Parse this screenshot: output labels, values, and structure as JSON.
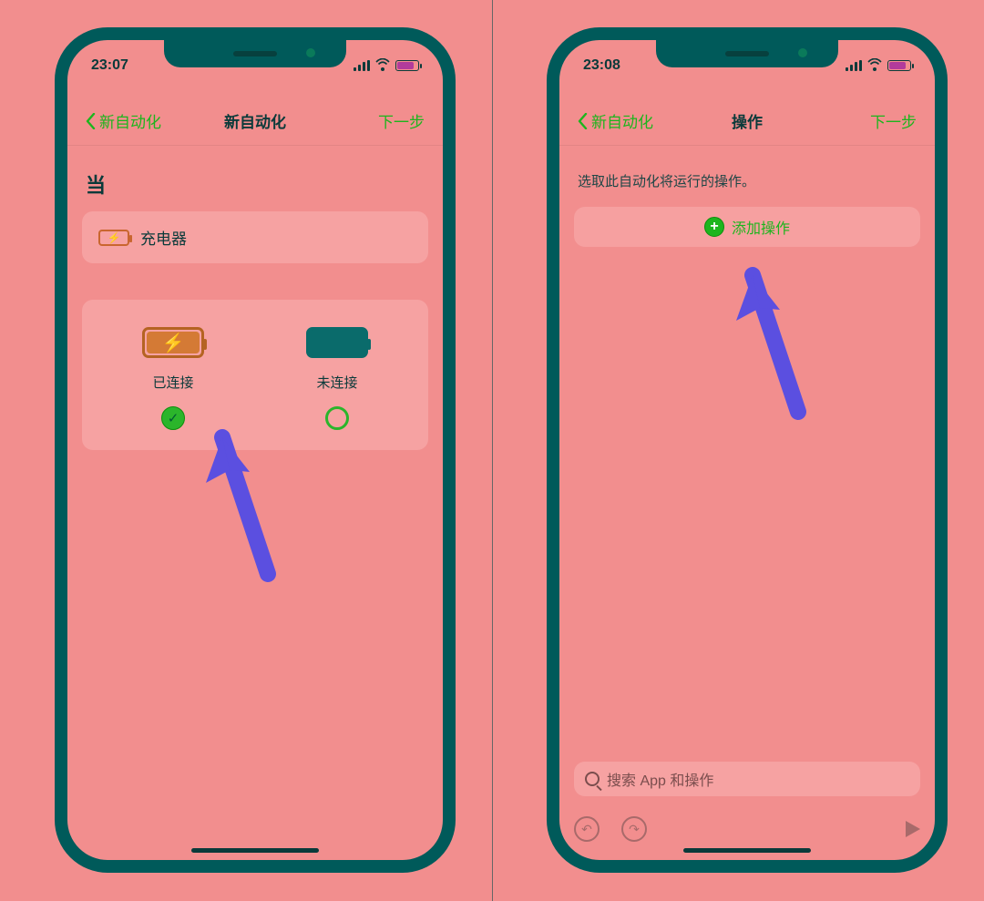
{
  "colors": {
    "accent_green": "#1db51d",
    "phone_frame": "#005a5a",
    "background_tint": "#f28e8e",
    "arrow": "#5b4fe0",
    "battery_status": "#b33b9b"
  },
  "phone_left": {
    "status_time": "23:07",
    "nav": {
      "back": "新自动化",
      "title": "新自动化",
      "next": "下一步"
    },
    "when_label": "当",
    "trigger": {
      "label": "充电器",
      "icon": "charger-icon"
    },
    "options": [
      {
        "id": "connected",
        "label": "已连接",
        "icon": "battery-charging-icon",
        "selected": true
      },
      {
        "id": "disconnected",
        "label": "未连接",
        "icon": "battery-full-icon",
        "selected": false
      }
    ]
  },
  "phone_right": {
    "status_time": "23:08",
    "nav": {
      "back": "新自动化",
      "title": "操作",
      "next": "下一步"
    },
    "prompt": "选取此自动化将运行的操作。",
    "add_action_label": "添加操作",
    "search_placeholder": "搜索 App 和操作",
    "toolbar": {
      "undo": "undo-icon",
      "redo": "redo-icon",
      "play": "play-icon"
    }
  }
}
